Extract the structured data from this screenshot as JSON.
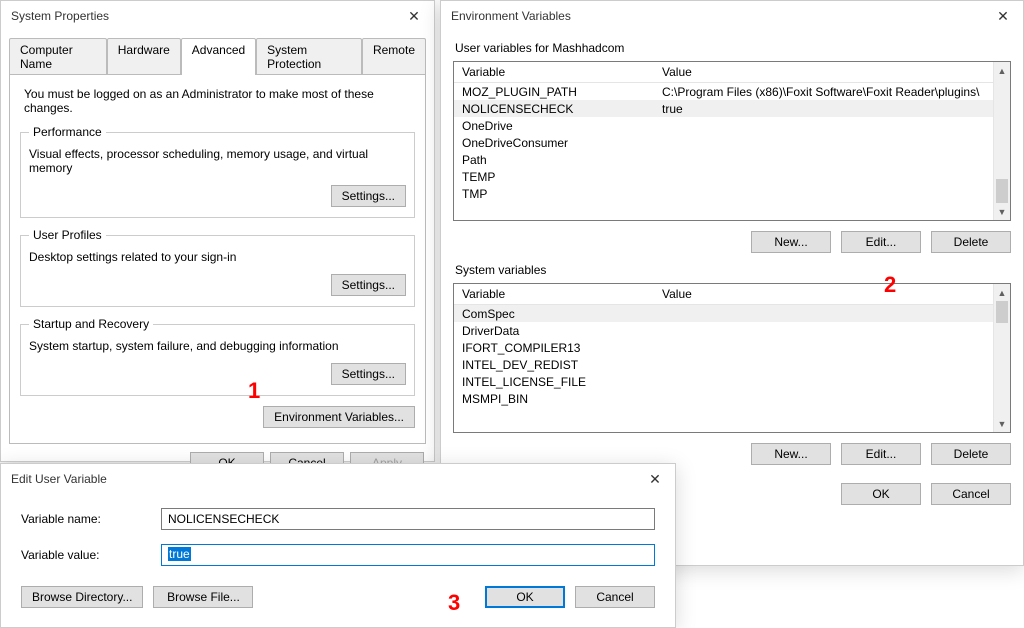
{
  "sysprops": {
    "title": "System Properties",
    "tabs": [
      "Computer Name",
      "Hardware",
      "Advanced",
      "System Protection",
      "Remote"
    ],
    "active_tab": 2,
    "admin_hint": "You must be logged on as an Administrator to make most of these changes.",
    "perf": {
      "legend": "Performance",
      "text": "Visual effects, processor scheduling, memory usage, and virtual memory",
      "btn": "Settings..."
    },
    "userprof": {
      "legend": "User Profiles",
      "text": "Desktop settings related to your sign-in",
      "btn": "Settings..."
    },
    "startup": {
      "legend": "Startup and Recovery",
      "text": "System startup, system failure, and debugging information",
      "btn": "Settings..."
    },
    "envbtn": "Environment Variables...",
    "ok": "OK",
    "cancel": "Cancel",
    "apply": "Apply"
  },
  "env": {
    "title": "Environment Variables",
    "user_label": "User variables for Mashhadcom",
    "sys_label": "System variables",
    "col_var": "Variable",
    "col_val": "Value",
    "user_vars": [
      {
        "name": "MOZ_PLUGIN_PATH",
        "value": "C:\\Program Files (x86)\\Foxit Software\\Foxit Reader\\plugins\\"
      },
      {
        "name": "NOLICENSECHECK",
        "value": "true"
      },
      {
        "name": "OneDrive",
        "value": ""
      },
      {
        "name": "OneDriveConsumer",
        "value": ""
      },
      {
        "name": "Path",
        "value": ""
      },
      {
        "name": "TEMP",
        "value": ""
      },
      {
        "name": "TMP",
        "value": ""
      }
    ],
    "user_selected_index": 1,
    "sys_vars": [
      {
        "name": "ComSpec",
        "value": ""
      },
      {
        "name": "DriverData",
        "value": ""
      },
      {
        "name": "IFORT_COMPILER13",
        "value": ""
      },
      {
        "name": "INTEL_DEV_REDIST",
        "value": ""
      },
      {
        "name": "INTEL_LICENSE_FILE",
        "value": ""
      },
      {
        "name": "MSMPI_BIN",
        "value": ""
      }
    ],
    "sys_selected_index": 0,
    "new": "New...",
    "edit": "Edit...",
    "delete": "Delete",
    "ok": "OK",
    "cancel": "Cancel"
  },
  "editdlg": {
    "title": "Edit User Variable",
    "name_label": "Variable name:",
    "name_value": "NOLICENSECHECK",
    "value_label": "Variable value:",
    "value_value": "true",
    "browse_dir": "Browse Directory...",
    "browse_file": "Browse File...",
    "ok": "OK",
    "cancel": "Cancel"
  },
  "callouts": {
    "one": "1",
    "two": "2",
    "three": "3"
  }
}
